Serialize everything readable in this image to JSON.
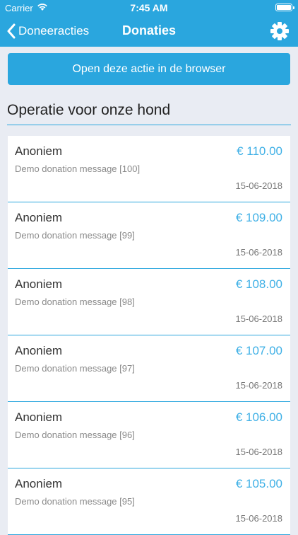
{
  "status": {
    "carrier": "Carrier",
    "time": "7:45 AM"
  },
  "nav": {
    "back_label": "Doneeracties",
    "title": "Donaties"
  },
  "browser_button": {
    "label": "Open deze actie in de browser"
  },
  "section": {
    "title": "Operatie voor onze hond"
  },
  "donations": [
    {
      "name": "Anoniem",
      "amount": "€ 110.00",
      "message": "Demo donation message [100]",
      "date": "15-06-2018"
    },
    {
      "name": "Anoniem",
      "amount": "€ 109.00",
      "message": "Demo donation message [99]",
      "date": "15-06-2018"
    },
    {
      "name": "Anoniem",
      "amount": "€ 108.00",
      "message": "Demo donation message [98]",
      "date": "15-06-2018"
    },
    {
      "name": "Anoniem",
      "amount": "€ 107.00",
      "message": "Demo donation message [97]",
      "date": "15-06-2018"
    },
    {
      "name": "Anoniem",
      "amount": "€ 106.00",
      "message": "Demo donation message [96]",
      "date": "15-06-2018"
    },
    {
      "name": "Anoniem",
      "amount": "€ 105.00",
      "message": "Demo donation message [95]",
      "date": "15-06-2018"
    }
  ],
  "colors": {
    "accent": "#2aa6de",
    "amount": "#3fb0e6",
    "background": "#e9ecf3"
  },
  "icons": {
    "back": "chevron-left-icon",
    "settings": "gear-icon",
    "wifi": "wifi-icon",
    "battery": "battery-icon"
  }
}
